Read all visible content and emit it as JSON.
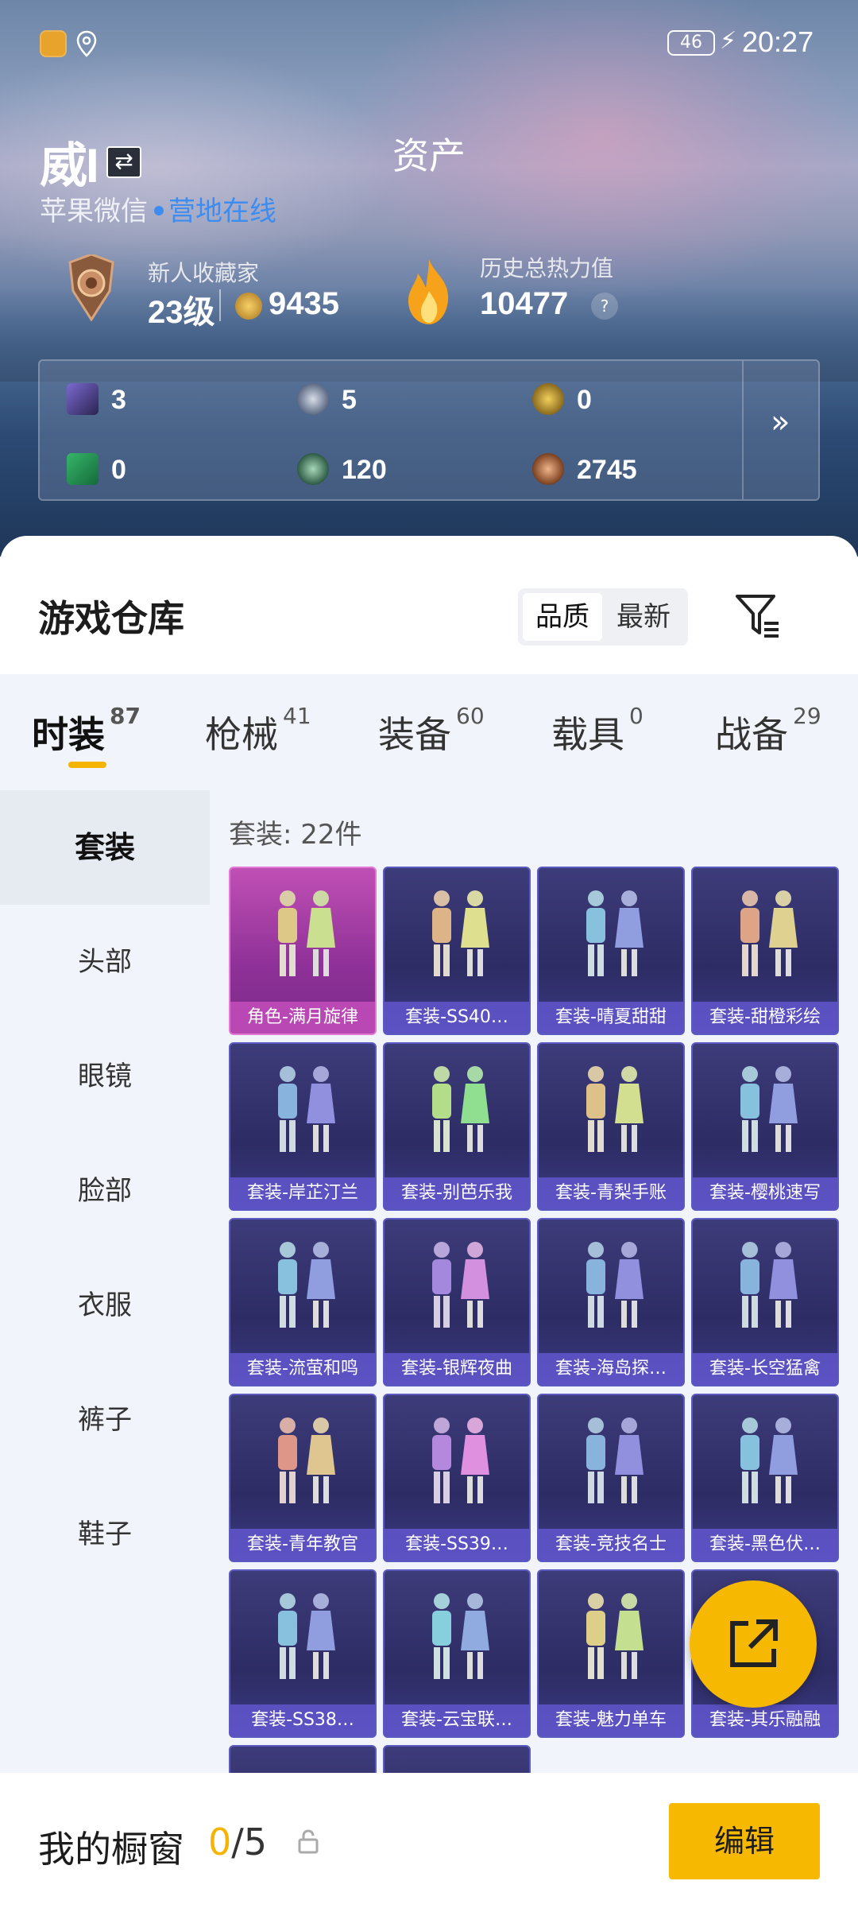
{
  "status_bar": {
    "battery": "46",
    "time": "20:27"
  },
  "header": {
    "logo_text": "威I",
    "page_title": "资产",
    "account": "苹果微信",
    "online_status": "营地在线"
  },
  "profile": {
    "collector_title": "新人收藏家",
    "level": "23级",
    "points": "9435",
    "heat_label": "历史总热力值",
    "heat_value": "10477",
    "help_label": "?"
  },
  "currencies": [
    {
      "icon": "card-icon",
      "value": "3"
    },
    {
      "icon": "silver-coin-icon",
      "value": "5"
    },
    {
      "icon": "gold-coin-icon",
      "value": "0"
    },
    {
      "icon": "green-ticket-icon",
      "value": "0"
    },
    {
      "icon": "green-coin-icon",
      "value": "120"
    },
    {
      "icon": "bronze-coin-icon",
      "value": "2745"
    }
  ],
  "currency_more": "»",
  "warehouse": {
    "title": "游戏仓库",
    "sort_options": [
      "品质",
      "最新"
    ],
    "sort_active": "品质"
  },
  "categories": [
    {
      "label": "时装",
      "count": "87",
      "active": true
    },
    {
      "label": "枪械",
      "count": "41"
    },
    {
      "label": "装备",
      "count": "60"
    },
    {
      "label": "载具",
      "count": "0"
    },
    {
      "label": "战备",
      "count": "29"
    }
  ],
  "subcategories": [
    "套装",
    "头部",
    "眼镜",
    "脸部",
    "衣服",
    "裤子",
    "鞋子"
  ],
  "item_count_label": "套装: 22件",
  "items": [
    "角色-满月旋律",
    "套装-SS40…",
    "套装-晴夏甜甜",
    "套装-甜橙彩绘",
    "套装-岸芷汀兰",
    "套装-别芭乐我",
    "套装-青梨手账",
    "套装-樱桃速写",
    "套装-流萤和鸣",
    "套装-银辉夜曲",
    "套装-海岛探…",
    "套装-长空猛禽",
    "套装-青年教官",
    "套装-SS39…",
    "套装-竞技名士",
    "套装-黑色伏…",
    "套装-SS38…",
    "套装-云宝联…",
    "套装-魅力单车",
    "套装-其乐融融"
  ],
  "footer": {
    "title": "我的橱窗",
    "count_current": "0",
    "count_sep": "/",
    "count_total": "5",
    "edit_label": "编辑"
  },
  "colors": {
    "accent": "#f6b800",
    "link": "#3d8cf0",
    "card_purple": "#3d3c7a",
    "card_pink": "#c04fb4"
  }
}
